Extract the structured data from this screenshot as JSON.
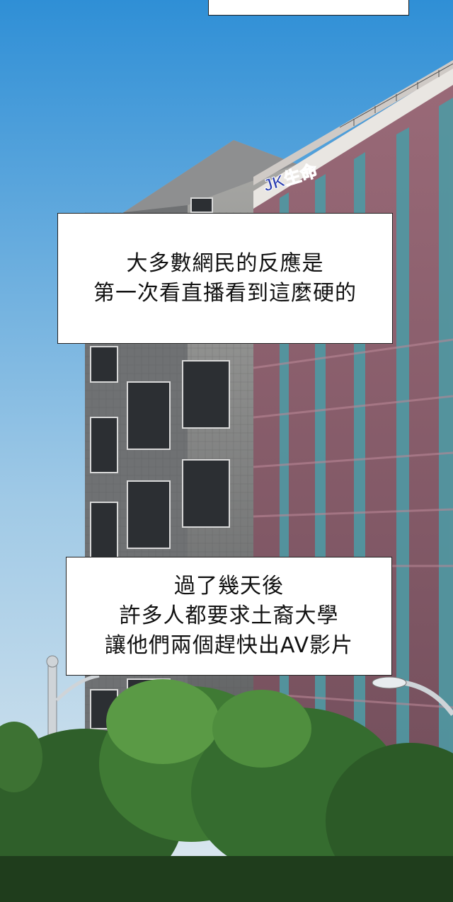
{
  "captions": {
    "top_box": "",
    "box1": {
      "lines": [
        "大多數網民的反應是",
        "第一次看直播看到這麼硬的"
      ]
    },
    "box2": {
      "lines": [
        "過了幾天後",
        "許多人都要求土裔大學",
        "讓他們兩個趕快出AV影片"
      ]
    }
  },
  "building_sign": "JK生命",
  "colors": {
    "sky_top": "#2f8fd6",
    "sky_bottom": "#e8f2f8",
    "tower_pink": "#8c5f6e",
    "tower_teal": "#4f99a3",
    "office_gray": "#7d7f80",
    "trees": "#2f6b2c"
  }
}
